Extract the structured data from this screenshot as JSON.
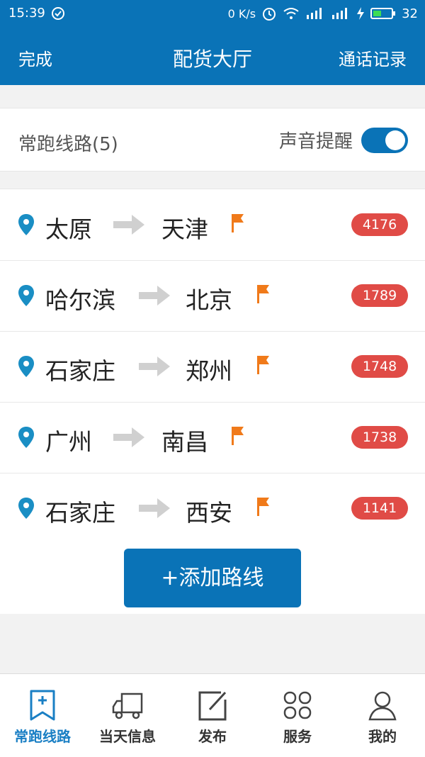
{
  "status_bar": {
    "time": "15:39",
    "net_speed": "0 K/s",
    "battery": "32"
  },
  "nav": {
    "left": "完成",
    "title": "配货大厅",
    "right": "通话记录"
  },
  "routes_header": {
    "label": "常跑线路(5)",
    "sound_label": "声音提醒",
    "sound_on": true
  },
  "routes": [
    {
      "from": "太原",
      "to": "天津",
      "count": "4176"
    },
    {
      "from": "哈尔滨",
      "to": "北京",
      "count": "1789"
    },
    {
      "from": "石家庄",
      "to": "郑州",
      "count": "1748"
    },
    {
      "from": "广州",
      "to": "南昌",
      "count": "1738"
    },
    {
      "from": "石家庄",
      "to": "西安",
      "count": "1141"
    }
  ],
  "add_route_label": "+添加路线",
  "tabs": [
    {
      "label": "常跑线路",
      "icon": "bookmark-plus-icon",
      "active": true
    },
    {
      "label": "当天信息",
      "icon": "truck-icon",
      "active": false
    },
    {
      "label": "发布",
      "icon": "edit-icon",
      "active": false
    },
    {
      "label": "服务",
      "icon": "grid-icon",
      "active": false
    },
    {
      "label": "我的",
      "icon": "user-icon",
      "active": false
    }
  ],
  "colors": {
    "primary": "#0a73b7",
    "badge": "#e04b46",
    "flag": "#f07a1a",
    "pin": "#1a8ec4",
    "arrow": "#d0d0d0"
  }
}
